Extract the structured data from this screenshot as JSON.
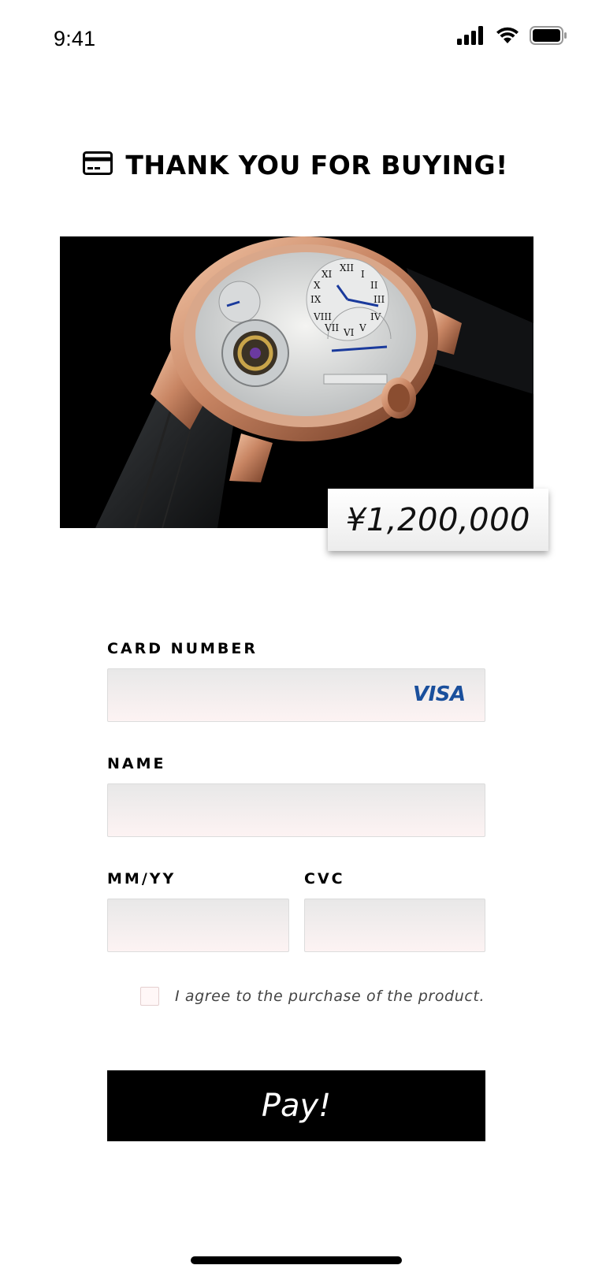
{
  "status_bar": {
    "time": "9:41",
    "icons": [
      "signal-icon",
      "wifi-icon",
      "battery-icon"
    ]
  },
  "header": {
    "icon": "credit-card-icon",
    "title": "THANK YOU FOR BUYING!"
  },
  "product": {
    "image": "watch-image",
    "price": "¥1,200,000"
  },
  "form": {
    "card_number_label": "CARD NUMBER",
    "card_number_value": "",
    "card_brand": "VISA",
    "name_label": "NAME",
    "name_value": "",
    "expiry_label": "MM/YY",
    "expiry_value": "",
    "cvc_label": "CVC",
    "cvc_value": "",
    "agree_text": "I agree to the purchase of the product.",
    "agree_checked": false,
    "pay_label": "Pay!"
  },
  "colors": {
    "accent": "#000000",
    "input_bg_top": "#e8e8e8",
    "input_bg_bottom": "#fdf3f3",
    "visa_blue": "#1a4f9c"
  }
}
